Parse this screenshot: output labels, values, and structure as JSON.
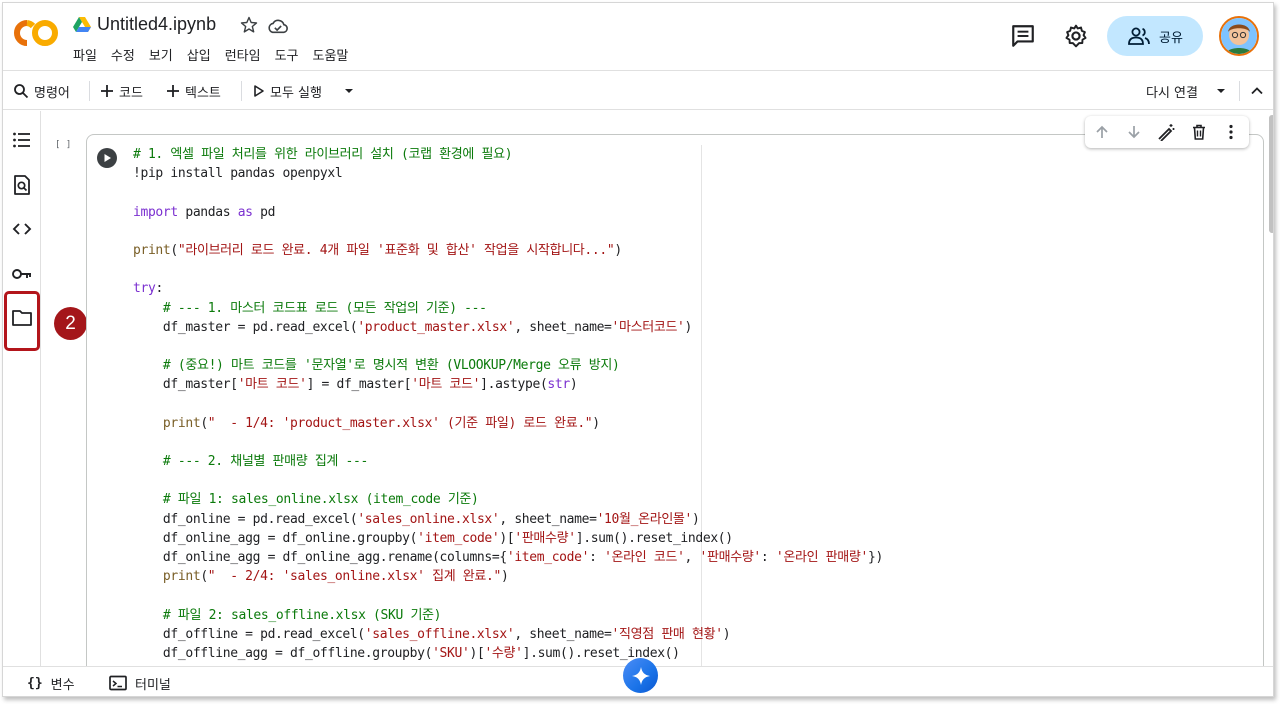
{
  "header": {
    "logo_text": "CO",
    "notebook_title": "Untitled4.ipynb",
    "menu": [
      "파일",
      "수정",
      "보기",
      "삽입",
      "런타임",
      "도구",
      "도움말"
    ],
    "share_label": "공유"
  },
  "toolbar": {
    "commands_label": "명령어",
    "code_label": "코드",
    "text_label": "텍스트",
    "run_all_label": "모두 실행",
    "reconnect_label": "다시 연결"
  },
  "annotation": {
    "badge_number": "2"
  },
  "cell": {
    "exec_count": "[ ]",
    "lines": [
      [
        [
          "c-com",
          "# 1. 엑셀 파일 처리를 위한 라이브러리 설치 (코랩 환경에 필요)"
        ]
      ],
      [
        [
          "c-txt",
          "!pip install pandas openpyxl"
        ]
      ],
      [],
      [
        [
          "c-kw",
          "import"
        ],
        [
          "c-txt",
          " pandas "
        ],
        [
          "c-kw",
          "as"
        ],
        [
          "c-txt",
          " pd"
        ]
      ],
      [],
      [
        [
          "c-fn",
          "print"
        ],
        [
          "c-txt",
          "("
        ],
        [
          "c-str",
          "\"라이브러리 로드 완료. 4개 파일 '표준화 및 합산' 작업을 시작합니다...\""
        ],
        [
          "c-txt",
          ")"
        ]
      ],
      [],
      [
        [
          "c-kw",
          "try"
        ],
        [
          "c-txt",
          ":"
        ]
      ],
      [
        [
          "c-txt",
          "    "
        ],
        [
          "c-com",
          "# --- 1. 마스터 코드표 로드 (모든 작업의 기준) ---"
        ]
      ],
      [
        [
          "c-txt",
          "    df_master = pd.read_excel("
        ],
        [
          "c-str",
          "'product_master.xlsx'"
        ],
        [
          "c-txt",
          ", sheet_name="
        ],
        [
          "c-str",
          "'마스터코드'"
        ],
        [
          "c-txt",
          ")"
        ]
      ],
      [],
      [
        [
          "c-txt",
          "    "
        ],
        [
          "c-com",
          "# (중요!) 마트 코드를 '문자열'로 명시적 변환 (VLOOKUP/Merge 오류 방지)"
        ]
      ],
      [
        [
          "c-txt",
          "    df_master["
        ],
        [
          "c-str",
          "'마트 코드'"
        ],
        [
          "c-txt",
          "] = df_master["
        ],
        [
          "c-str",
          "'마트 코드'"
        ],
        [
          "c-txt",
          "].astype("
        ],
        [
          "c-kw",
          "str"
        ],
        [
          "c-txt",
          ")"
        ]
      ],
      [],
      [
        [
          "c-txt",
          "    "
        ],
        [
          "c-fn",
          "print"
        ],
        [
          "c-txt",
          "("
        ],
        [
          "c-str",
          "\"  - 1/4: 'product_master.xlsx' (기준 파일) 로드 완료.\""
        ],
        [
          "c-txt",
          ")"
        ]
      ],
      [],
      [
        [
          "c-txt",
          "    "
        ],
        [
          "c-com",
          "# --- 2. 채널별 판매량 집계 ---"
        ]
      ],
      [],
      [
        [
          "c-txt",
          "    "
        ],
        [
          "c-com",
          "# 파일 1: sales_online.xlsx (item_code 기준)"
        ]
      ],
      [
        [
          "c-txt",
          "    df_online = pd.read_excel("
        ],
        [
          "c-str",
          "'sales_online.xlsx'"
        ],
        [
          "c-txt",
          ", sheet_name="
        ],
        [
          "c-str",
          "'10월_온라인몰'"
        ],
        [
          "c-txt",
          ")"
        ]
      ],
      [
        [
          "c-txt",
          "    df_online_agg = df_online.groupby("
        ],
        [
          "c-str",
          "'item_code'"
        ],
        [
          "c-txt",
          ")["
        ],
        [
          "c-str",
          "'판매수량'"
        ],
        [
          "c-txt",
          "].sum().reset_index()"
        ]
      ],
      [
        [
          "c-txt",
          "    df_online_agg = df_online_agg.rename(columns={"
        ],
        [
          "c-str",
          "'item_code'"
        ],
        [
          "c-txt",
          ": "
        ],
        [
          "c-str",
          "'온라인 코드'"
        ],
        [
          "c-txt",
          ", "
        ],
        [
          "c-str",
          "'판매수량'"
        ],
        [
          "c-txt",
          ": "
        ],
        [
          "c-str",
          "'온라인 판매량'"
        ],
        [
          "c-txt",
          "})"
        ]
      ],
      [
        [
          "c-txt",
          "    "
        ],
        [
          "c-fn",
          "print"
        ],
        [
          "c-txt",
          "("
        ],
        [
          "c-str",
          "\"  - 2/4: 'sales_online.xlsx' 집계 완료.\""
        ],
        [
          "c-txt",
          ")"
        ]
      ],
      [],
      [
        [
          "c-txt",
          "    "
        ],
        [
          "c-com",
          "# 파일 2: sales_offline.xlsx (SKU 기준)"
        ]
      ],
      [
        [
          "c-txt",
          "    df_offline = pd.read_excel("
        ],
        [
          "c-str",
          "'sales_offline.xlsx'"
        ],
        [
          "c-txt",
          ", sheet_name="
        ],
        [
          "c-str",
          "'직영점 판매 현황'"
        ],
        [
          "c-txt",
          ")"
        ]
      ],
      [
        [
          "c-txt",
          "    df_offline_agg = df_offline.groupby("
        ],
        [
          "c-str",
          "'SKU'"
        ],
        [
          "c-txt",
          ")["
        ],
        [
          "c-str",
          "'수량'"
        ],
        [
          "c-txt",
          "].sum().reset_index()"
        ]
      ]
    ]
  },
  "footer": {
    "variables_label": "변수",
    "terminal_label": "터미널"
  },
  "colors": {
    "accent": "#c2e7ff",
    "annotation_red": "#b3151b",
    "logo_orange": "#f9ab00"
  }
}
